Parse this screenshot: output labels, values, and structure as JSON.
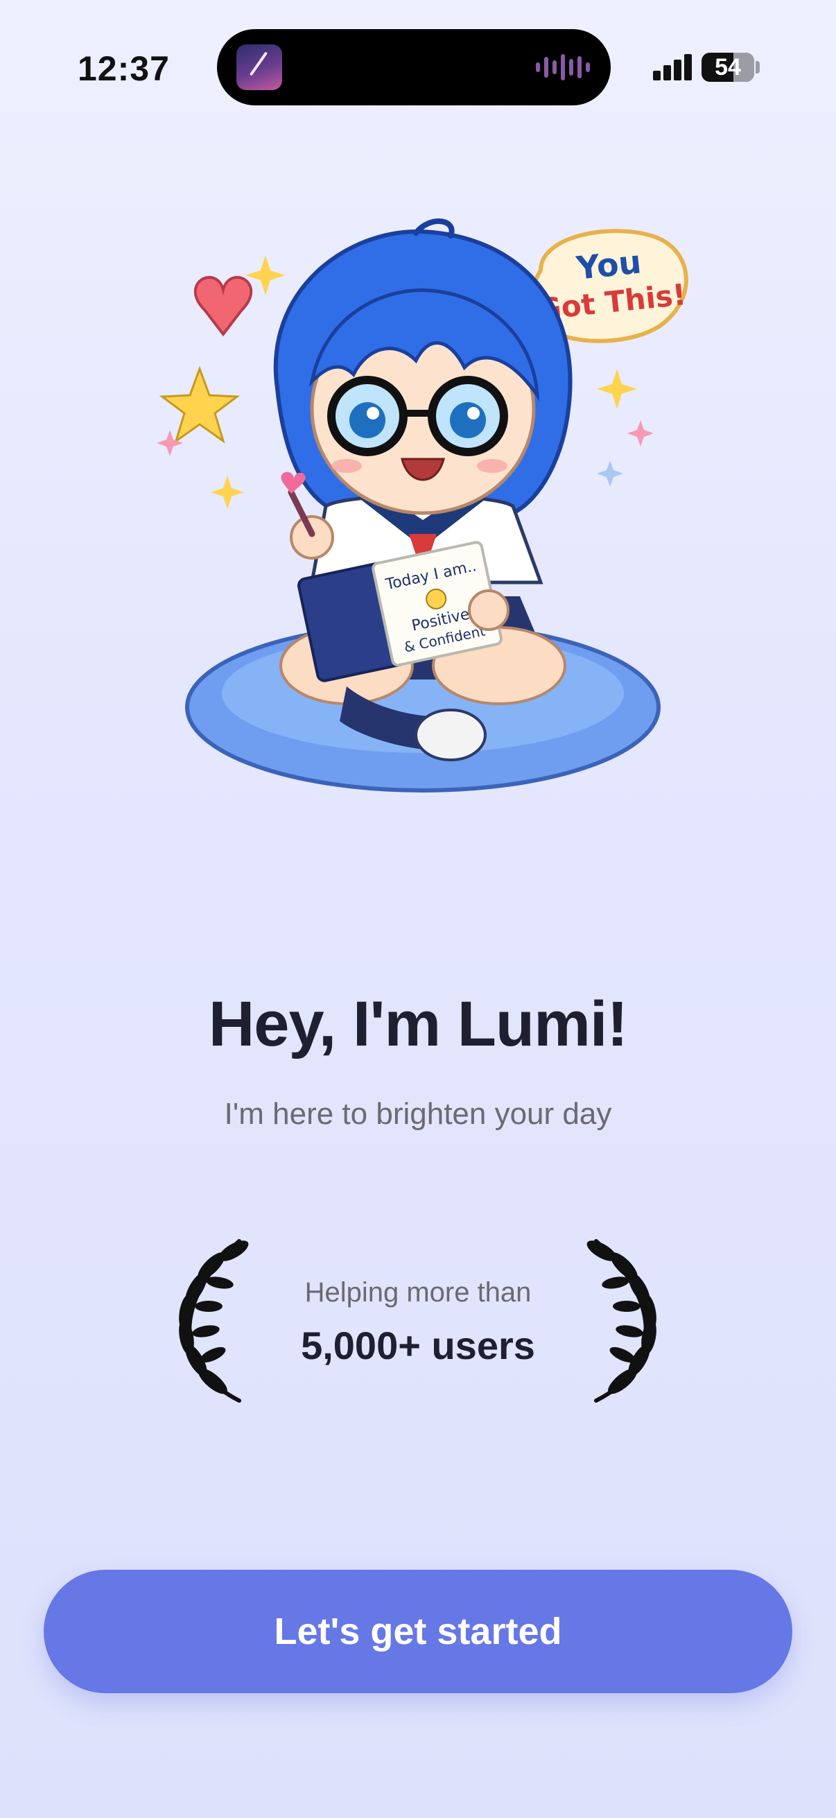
{
  "status_bar": {
    "time": "12:37",
    "battery": "54",
    "icons": [
      "now-playing-thumbnail-icon",
      "audio-waveform-icon",
      "cellular-signal-icon",
      "battery-icon"
    ]
  },
  "hero": {
    "illustration": "lumi-mascot-illustration",
    "speech_bubble": "You Got This!",
    "notebook_text": [
      "Today I am..",
      "Positive",
      "& Confident"
    ]
  },
  "welcome": {
    "title": "Hey, I'm Lumi!",
    "subtitle": "I'm here to brighten your day"
  },
  "social_proof": {
    "label": "Helping more than",
    "value": "5,000+ users",
    "icons": [
      "laurel-left-icon",
      "laurel-right-icon"
    ]
  },
  "cta": {
    "label": "Let's get started"
  },
  "colors": {
    "background": "#e4e7fd",
    "accent": "#6677e6",
    "title": "#1e1f30",
    "muted_text": "#6a6a72"
  }
}
